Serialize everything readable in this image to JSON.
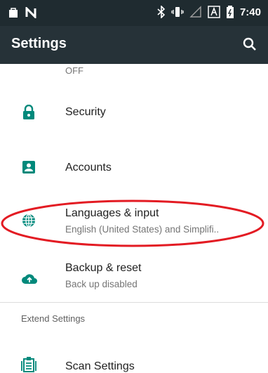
{
  "status_bar": {
    "time": "7:40",
    "icons": [
      "bag-icon",
      "no-signal-n-icon",
      "bluetooth-icon",
      "vibrate-icon",
      "signal-icon",
      "a-icon",
      "battery-icon"
    ]
  },
  "app_bar": {
    "title": "Settings",
    "search_icon": "search-icon"
  },
  "list": {
    "partial_item_subtitle": "OFF",
    "items": [
      {
        "icon": "lock-icon",
        "title": "Security"
      },
      {
        "icon": "account-icon",
        "title": "Accounts"
      },
      {
        "icon": "globe-icon",
        "title": "Languages & input",
        "subtitle": "English (United States) and Simplifi.."
      },
      {
        "icon": "cloud-upload-icon",
        "title": "Backup & reset",
        "subtitle": "Back up disabled"
      }
    ],
    "section_header": "Extend Settings",
    "extend_items": [
      {
        "icon": "scan-icon",
        "title": "Scan Settings"
      }
    ]
  },
  "colors": {
    "accent": "#00897b",
    "app_bar": "#263238",
    "status_bar": "#1f2b30",
    "annotation": "#e31b23"
  }
}
